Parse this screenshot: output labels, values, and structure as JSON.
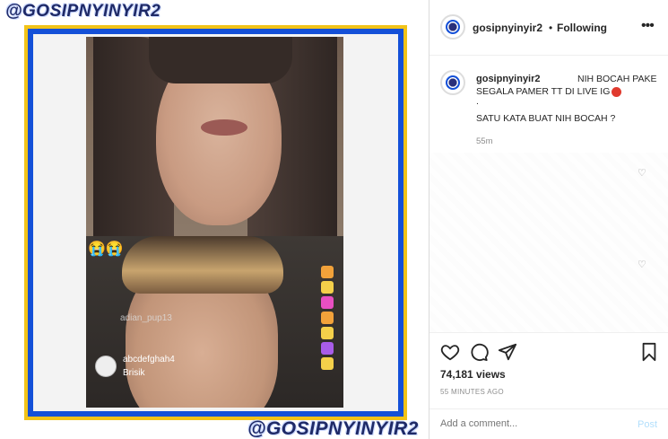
{
  "media": {
    "watermark_top": "@GOSIPNYINYIR2",
    "watermark_bottom": "@GOSIPNYINYIR2",
    "video": {
      "emoji": "😭😭",
      "comment_faded": "adian_pup13",
      "comment_user": "abcdefghah4",
      "comment_text": "Brisik"
    },
    "frame_colors": {
      "outer": "#f2c318",
      "inner": "#1450d8"
    }
  },
  "post": {
    "header": {
      "username": "gosipnyinyir2",
      "separator": "•",
      "follow_status": "Following",
      "more_icon": "more-horizontal-icon"
    },
    "caption": {
      "username": "gosipnyinyir2",
      "line1": "NIH BOCAH PAKE",
      "line2": "SEGALA PAMER TT DI LIVE IG",
      "line3": ".",
      "line4": "SATU KATA BUAT NIH BOCAH ?",
      "time": "55m"
    },
    "actions": {
      "like_icon": "heart-icon",
      "comment_icon": "comment-icon",
      "share_icon": "paper-plane-icon",
      "save_icon": "bookmark-icon"
    },
    "views": "74,181 views",
    "posted_ago": "55 MINUTES AGO",
    "comment_box": {
      "placeholder": "Add a comment...",
      "post_label": "Post"
    }
  }
}
